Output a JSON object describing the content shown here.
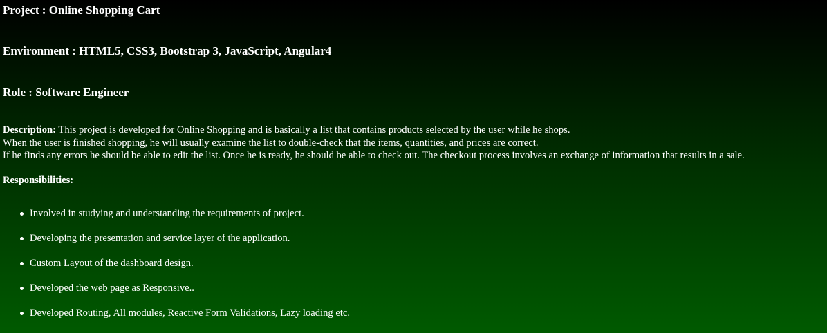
{
  "project": "Project : Online Shopping Cart",
  "environment": "Environment : HTML5, CSS3, Bootstrap 3, JavaScript, Angular4",
  "role": "Role : Software Engineer",
  "description": {
    "label": "Description:",
    "line1": " This project is developed for Online Shopping and is basically a list that contains products selected by the user while he shops.",
    "line2": "When the user is finished shopping, he will usually examine the list to double-check that the items, quantities, and prices are correct.",
    "line3": "If he finds any errors he should be able to edit the list. Once he is ready, he should be able to check out. The checkout process involves an exchange of information that results in a sale."
  },
  "responsibilities": {
    "label": "Responsibilities:",
    "items": [
      "Involved in studying and understanding the requirements of project.",
      "Developing the presentation and service layer of the application.",
      "Custom Layout of the dashboard design.",
      "Developed the web page as Responsive..",
      "Developed Routing, All modules, Reactive Form Validations, Lazy loading etc."
    ]
  },
  "colors": {
    "background_top": "#000000",
    "background_bottom": "#005a00",
    "text": "#ffffff"
  }
}
